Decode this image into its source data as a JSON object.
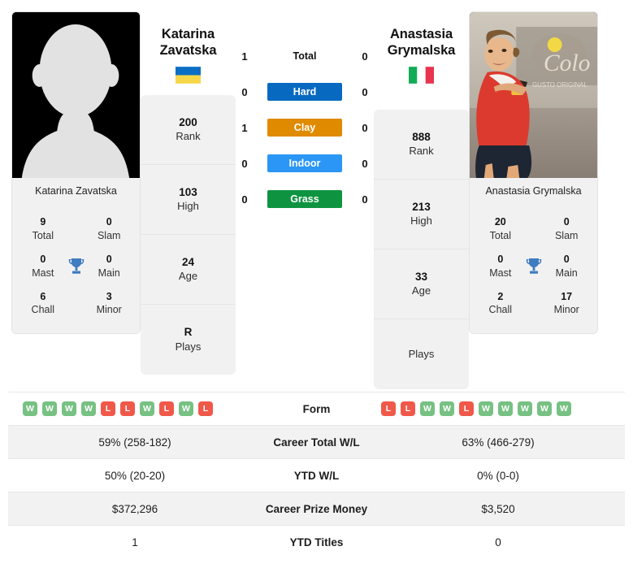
{
  "left_player": {
    "name_line1": "Katarina",
    "name_line2": "Zavatska",
    "full_name": "Katarina Zavatska",
    "flag_name": "ukraine-flag",
    "photo_name": "placeholder-avatar",
    "stats": [
      {
        "value": "200",
        "label": "Rank"
      },
      {
        "value": "103",
        "label": "High"
      },
      {
        "value": "24",
        "label": "Age"
      },
      {
        "value": "R",
        "label": "Plays"
      }
    ],
    "titles": [
      {
        "value": "9",
        "label": "Total",
        "value2": "0",
        "label2": "Slam"
      },
      {
        "value": "0",
        "label": "Mast",
        "value2": "0",
        "label2": "Main"
      },
      {
        "value": "6",
        "label": "Chall",
        "value2": "3",
        "label2": "Minor"
      }
    ],
    "form": [
      "W",
      "W",
      "W",
      "W",
      "L",
      "L",
      "W",
      "L",
      "W",
      "L"
    ]
  },
  "right_player": {
    "name_line1": "Anastasia",
    "name_line2": "Grymalska",
    "full_name": "Anastasia Grymalska",
    "flag_name": "italy-flag",
    "photo_name": "player-action-photo",
    "stats": [
      {
        "value": "888",
        "label": "Rank"
      },
      {
        "value": "213",
        "label": "High"
      },
      {
        "value": "33",
        "label": "Age"
      },
      {
        "value": "",
        "label": "Plays"
      }
    ],
    "titles": [
      {
        "value": "20",
        "label": "Total",
        "value2": "0",
        "label2": "Slam"
      },
      {
        "value": "0",
        "label": "Mast",
        "value2": "0",
        "label2": "Main"
      },
      {
        "value": "2",
        "label": "Chall",
        "value2": "17",
        "label2": "Minor"
      }
    ],
    "form": [
      "L",
      "L",
      "W",
      "W",
      "L",
      "W",
      "W",
      "W",
      "W",
      "W"
    ]
  },
  "surfaces": [
    {
      "label": "Total",
      "left": "1",
      "right": "0",
      "color": "",
      "plain": true
    },
    {
      "label": "Hard",
      "left": "0",
      "right": "0",
      "color": "#0869c0"
    },
    {
      "label": "Clay",
      "left": "1",
      "right": "0",
      "color": "#e08a00"
    },
    {
      "label": "Indoor",
      "left": "0",
      "right": "0",
      "color": "#2b96f5"
    },
    {
      "label": "Grass",
      "left": "0",
      "right": "0",
      "color": "#0e9440"
    }
  ],
  "comparison": {
    "form_label": "Form",
    "rows": [
      {
        "left": "59% (258-182)",
        "label": "Career Total W/L",
        "right": "63% (466-279)"
      },
      {
        "left": "50% (20-20)",
        "label": "YTD W/L",
        "right": "0% (0-0)"
      },
      {
        "left": "$372,296",
        "label": "Career Prize Money",
        "right": "$3,520"
      },
      {
        "left": "1",
        "label": "YTD Titles",
        "right": "0"
      }
    ]
  },
  "colors": {
    "win": "#77c183",
    "loss": "#f0584a",
    "trophy": "#3f7cc0",
    "card_bg": "#f1f1f1"
  }
}
